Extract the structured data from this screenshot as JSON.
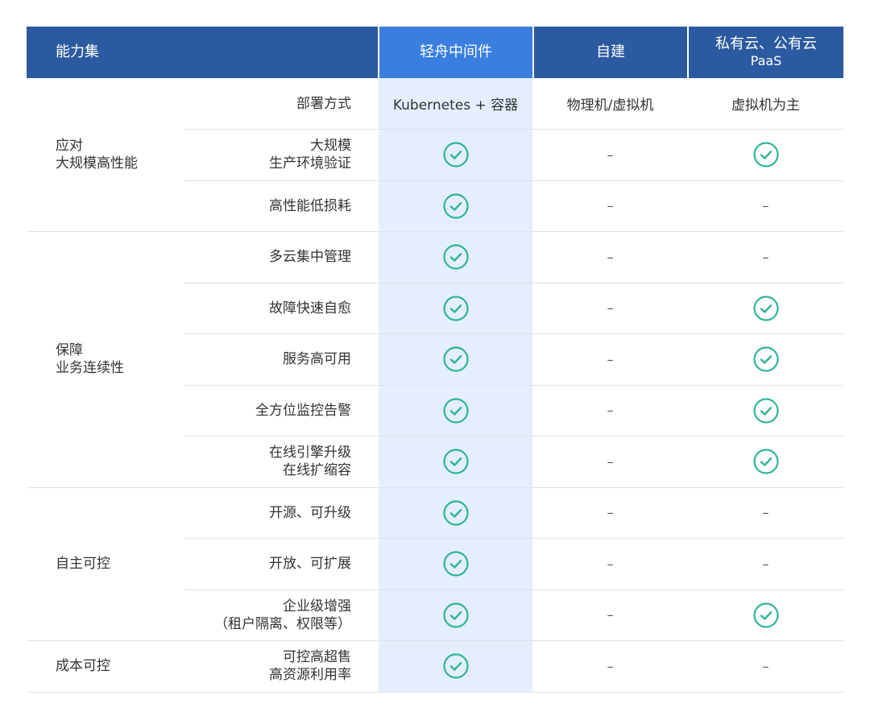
{
  "header": {
    "capability": "能力集",
    "product": "轻舟中间件",
    "self_built": "自建",
    "cloud_line1": "私有云、公有云",
    "cloud_line2": "PaaS"
  },
  "deployment": {
    "label": "部署方式",
    "product": "Kubernetes + 容器",
    "self_built": "物理机/虚拟机",
    "cloud": "虚拟机为主"
  },
  "groups": [
    {
      "lines": [
        "应对",
        "大规模高性能"
      ]
    },
    {
      "lines": [
        "保障",
        "业务连续性"
      ]
    },
    {
      "lines": [
        "自主可控"
      ]
    },
    {
      "lines": [
        "成本可控"
      ]
    }
  ],
  "rows": [
    {
      "label": [
        "大规模",
        "生产环境验证"
      ],
      "product": "check",
      "self_built": "–",
      "cloud": "check"
    },
    {
      "label": [
        "高性能低损耗"
      ],
      "product": "check",
      "self_built": "–",
      "cloud": "–"
    },
    {
      "label": [
        "多云集中管理"
      ],
      "product": "check",
      "self_built": "–",
      "cloud": "–"
    },
    {
      "label": [
        "故障快速自愈"
      ],
      "product": "check",
      "self_built": "–",
      "cloud": "check"
    },
    {
      "label": [
        "服务高可用"
      ],
      "product": "check",
      "self_built": "–",
      "cloud": "check"
    },
    {
      "label": [
        "全方位监控告警"
      ],
      "product": "check",
      "self_built": "–",
      "cloud": "check"
    },
    {
      "label": [
        "在线引擎升级",
        "在线扩缩容"
      ],
      "product": "check",
      "self_built": "–",
      "cloud": "check"
    },
    {
      "label": [
        "开源、可升级"
      ],
      "product": "check",
      "self_built": "–",
      "cloud": "–"
    },
    {
      "label": [
        "开放、可扩展"
      ],
      "product": "check",
      "self_built": "–",
      "cloud": "–"
    },
    {
      "label": [
        "企业级增强",
        "（租户隔离、权限等）"
      ],
      "product": "check",
      "self_built": "–",
      "cloud": "check"
    },
    {
      "label": [
        "可控高超售",
        "高资源利用率"
      ],
      "product": "check",
      "self_built": "–",
      "cloud": "–"
    }
  ],
  "colors": {
    "header_bg": "#2c5aa0",
    "header_highlight_bg": "#3a7ee0",
    "highlight_col_bg": "#e4eefc",
    "check_green": "#2fb598",
    "separator": "#dde3ee"
  },
  "icons": {
    "supported": "check-circle-icon"
  }
}
